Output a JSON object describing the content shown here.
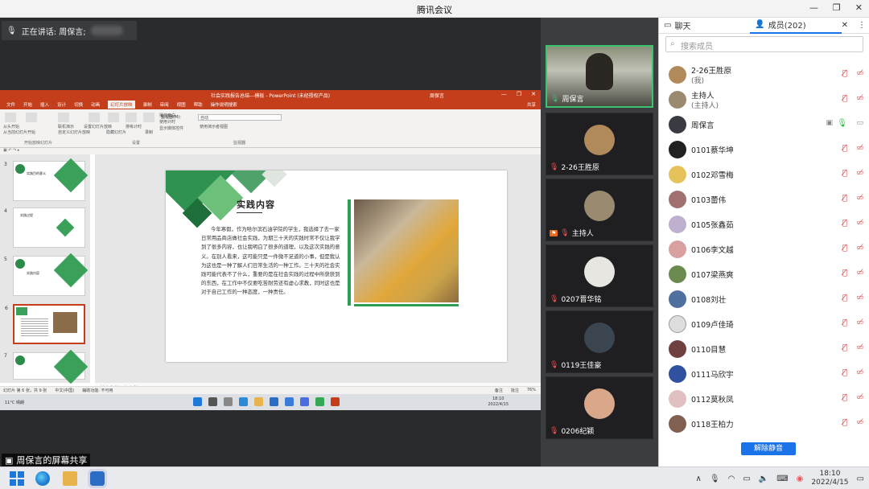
{
  "window": {
    "title": "腾讯会议",
    "controls": [
      "—",
      "❐",
      "✕"
    ]
  },
  "speaking": {
    "label": "正在讲话: 周保言;"
  },
  "share_label": "周保言的屏幕共享",
  "powerpoint": {
    "title": "社会实践报告总结---模板 - PowerPoint (未经授权产品)",
    "user": "周保言",
    "tabs": [
      "文件",
      "开始",
      "插入",
      "设计",
      "切换",
      "动画",
      "幻灯片放映",
      "录制",
      "审阅",
      "视图",
      "帮助",
      "操作说明搜索"
    ],
    "active_tab": "幻灯片放映",
    "share_btn": "共享",
    "ribbon_groups": [
      "开始放映幻灯片",
      "设置",
      "监视器"
    ],
    "ribbon_buttons": [
      "从头开始",
      "从当前幻灯片开始",
      "联机演示",
      "自定义幻灯片放映",
      "设置幻灯片放映",
      "隐藏幻灯片",
      "排练计时",
      "录制"
    ],
    "monitor_label": "监视器(M):",
    "monitor_value": "自动",
    "presenter_view": "使用演示者视图",
    "checkboxes": [
      "播放旁白",
      "使用计时",
      "显示媒体控件"
    ],
    "slide_numbers": [
      "3",
      "4",
      "5",
      "6",
      "7"
    ],
    "thumb_texts": [
      "实践目的意义",
      "实践过程",
      "实践内容"
    ],
    "slide": {
      "title": "实践内容",
      "body": "今年寒假，作为哈尔滨石油学院的学生，我选择了去一家日常用品商店做社会实践，为期三十天的实践时常不仅让我学到了很多内容，也让我明白了很多的道理，以及这次实践的意义。在别人看来，这可能只是一件微不足道的小事，但是我认为这也是一种了解人们日常生活的一种工作。三十天的社会实践可能代表不了什么，重要的是在社会实践的过程中所获获到的东西，在工作中不仅要吃苦耐劳还有虚心求教，同时这也是对于自己工作的一种态度，一种责任。"
    },
    "notes": "单击此处添加备注",
    "status_left": [
      "幻灯片 第 6 张，共 9 张",
      "中文(中国)",
      "辅助功能: 不可用"
    ],
    "status_right": [
      "备注",
      "批注",
      "76%"
    ],
    "inner_taskbar": {
      "weather_temp": "11°C",
      "weather_desc": "晴朗",
      "time": "18:10",
      "date": "2022/4/15"
    }
  },
  "tiles": [
    {
      "name": "周保言",
      "live": true
    },
    {
      "name": "2-26王胜原",
      "avatar_color": "#b08a5a"
    },
    {
      "name": "主持人",
      "host": true,
      "avatar_color": "#9a8a70"
    },
    {
      "name": "0207晋华铭",
      "avatar_color": "#e8e6e0"
    },
    {
      "name": "0119王佳豪",
      "avatar_color": "#3a4550"
    },
    {
      "name": "0206纪颖",
      "avatar_color": "#d9a78a"
    }
  ],
  "panel": {
    "tabs": {
      "chat": "聊天",
      "members": "成员(202)"
    },
    "search_placeholder": "搜索成员",
    "members": [
      {
        "name": "2-26王胜原",
        "sub": "(我)",
        "color": "#b08a5a"
      },
      {
        "name": "主持人",
        "sub": "(主持人)",
        "color": "#9a8a70"
      },
      {
        "name": "周保言",
        "speaking": true,
        "color": "#3a3a42"
      },
      {
        "name": "0101蔡华坤",
        "color": "#222"
      },
      {
        "name": "0102邓雪梅",
        "color": "#e6c35a"
      },
      {
        "name": "0103蕾伟",
        "color": "#a07070"
      },
      {
        "name": "0105张鑫茹",
        "color": "#c0b0d0"
      },
      {
        "name": "0106李文越",
        "color": "#d8a0a0"
      },
      {
        "name": "0107梁燕爽",
        "color": "#6a8a50"
      },
      {
        "name": "0108刘壮",
        "color": "#5070a0"
      },
      {
        "name": "0109卢佳琦",
        "color": "#ddd"
      },
      {
        "name": "0110目慧",
        "color": "#704040"
      },
      {
        "name": "0111马欣宇",
        "color": "#3050a0"
      },
      {
        "name": "0112莫秋凤",
        "color": "#e0c0c0"
      },
      {
        "name": "0118王柏力",
        "color": "#806050"
      }
    ],
    "unmute_button": "解除静音"
  },
  "taskbar": {
    "time": "18:10",
    "date": "2022/4/15"
  }
}
